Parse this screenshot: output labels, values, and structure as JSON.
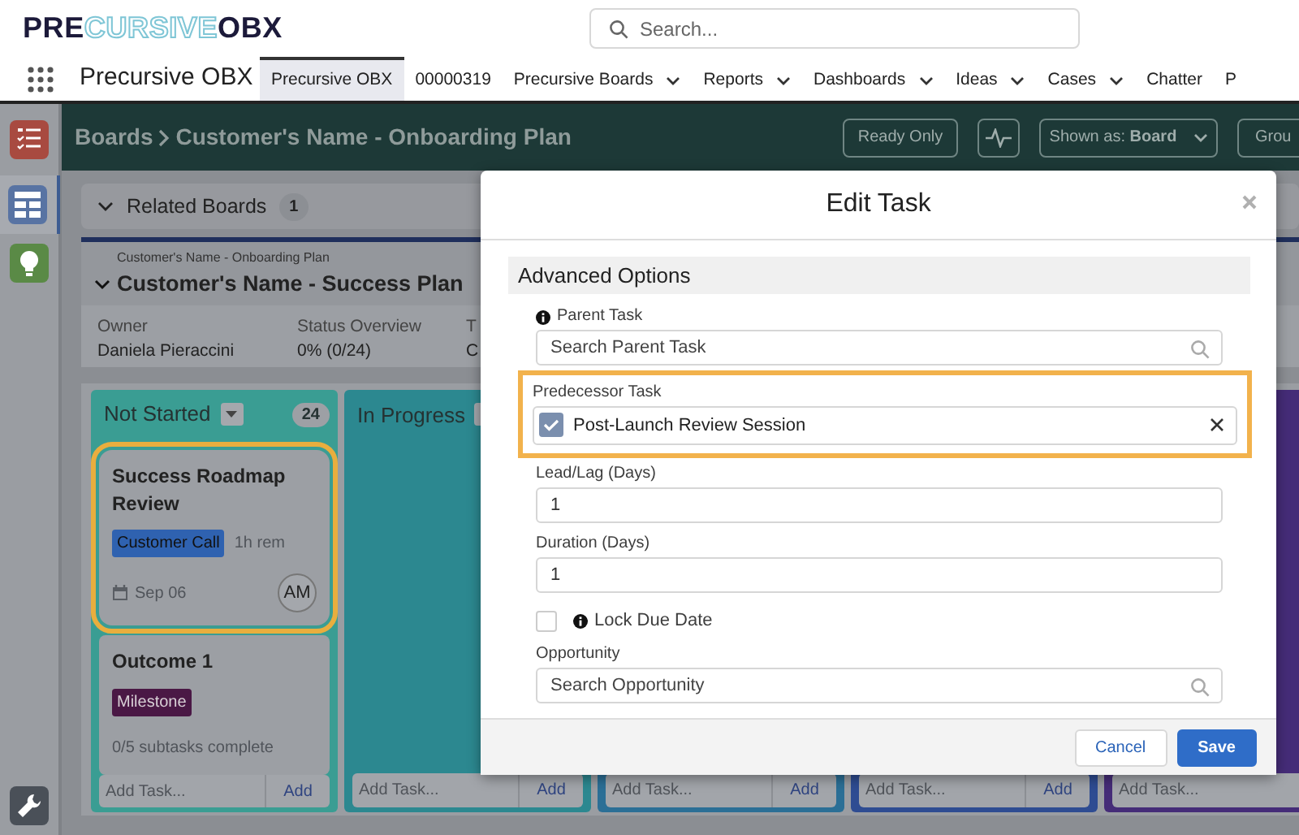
{
  "header": {
    "logo": [
      "PRE",
      "CURSIVE",
      "OBX"
    ],
    "search": {
      "placeholder": "Search..."
    }
  },
  "nav": {
    "app_name": "Precursive OBX",
    "tabs": [
      {
        "label": "Precursive OBX",
        "selected": true,
        "has_menu": false
      },
      {
        "label": "00000319",
        "selected": false,
        "has_menu": false
      },
      {
        "label": "Precursive Boards",
        "selected": false,
        "has_menu": true
      },
      {
        "label": "Reports",
        "selected": false,
        "has_menu": true
      },
      {
        "label": "Dashboards",
        "selected": false,
        "has_menu": true
      },
      {
        "label": "Ideas",
        "selected": false,
        "has_menu": true
      },
      {
        "label": "Cases",
        "selected": false,
        "has_menu": true
      },
      {
        "label": "Chatter",
        "selected": false,
        "has_menu": false
      },
      {
        "label": "P",
        "selected": false,
        "has_menu": false
      }
    ]
  },
  "sidebar": {
    "items": [
      {
        "kind": "checklist",
        "color": "#a84a40",
        "selected": false
      },
      {
        "kind": "grid",
        "color": "#5873a3",
        "selected": true
      },
      {
        "kind": "bulb",
        "color": "#5a8a46",
        "selected": false
      },
      {
        "kind": "wrench",
        "color": "#4a5058",
        "selected": false
      }
    ]
  },
  "toolbar": {
    "breadcrumb": [
      "Boards",
      "Customer's Name - Onboarding Plan"
    ],
    "buttons": [
      {
        "kind": "text",
        "label": "Ready Only"
      },
      {
        "kind": "icon"
      },
      {
        "kind": "dropdown",
        "label": "Shown as: **Board**"
      },
      {
        "kind": "text",
        "label": "Grou"
      }
    ]
  },
  "related_boards": {
    "title": "Related Boards",
    "count": "1"
  },
  "plan": {
    "parent": "Customer's Name - Onboarding Plan",
    "title": "Customer's Name - Success Plan",
    "fields": [
      {
        "label": "Owner",
        "value": "Daniela Pieraccini"
      },
      {
        "label": "Status Overview",
        "value": "0% (0/24)"
      },
      {
        "label": "T",
        "value": "C"
      }
    ]
  },
  "board": {
    "columns": [
      {
        "title": "Not Started",
        "count": "24",
        "color": "#3a9d93",
        "add_placeholder": "Add Task...",
        "add_button": "Add",
        "cards": [
          {
            "title": "Success Roadmap Review",
            "highlighted": true,
            "tag": {
              "label": "Customer Call",
              "color": "#2f62b0"
            },
            "remaining": "1h rem",
            "due": "Sep 06",
            "assignee": "AM"
          },
          {
            "title": "Outcome 1",
            "highlighted": false,
            "tag": {
              "label": "Milestone",
              "color": "#4a1845"
            },
            "progress": "0/5 subtasks complete"
          }
        ]
      },
      {
        "title": "In Progress",
        "color": "#2c8890",
        "add_placeholder": "Add Task...",
        "add_button": "Add"
      },
      {
        "color": "#2b6f96",
        "add_placeholder": "Add Task...",
        "add_button": "Add"
      },
      {
        "color": "#2e4c92",
        "add_placeholder": "Add Task...",
        "add_button": "Add"
      },
      {
        "color": "#452c78",
        "add_placeholder": "Add Task..."
      }
    ]
  },
  "modal": {
    "title": "Edit Task",
    "section": "Advanced Options",
    "fields": [
      {
        "kind": "lookup",
        "label": "Parent Task",
        "info": true,
        "highlighted": false,
        "placeholder": "Search Parent Task"
      },
      {
        "kind": "pill",
        "label": "Predecessor Task",
        "info": false,
        "highlighted": true,
        "value": "Post-Launch Review Session"
      },
      {
        "kind": "text",
        "label": "Lead/Lag (Days)",
        "info": false,
        "highlighted": false,
        "value": "1"
      },
      {
        "kind": "text",
        "label": "Duration (Days)",
        "info": false,
        "highlighted": false,
        "value": "1"
      },
      {
        "kind": "checkbox",
        "label": "Lock Due Date",
        "info": true,
        "highlighted": false,
        "checked": false
      },
      {
        "kind": "lookup",
        "label": "Opportunity",
        "info": false,
        "highlighted": false,
        "placeholder": "Search Opportunity"
      }
    ],
    "buttons": [
      {
        "label": "Cancel",
        "primary": false
      },
      {
        "label": "Save",
        "primary": true
      }
    ]
  }
}
